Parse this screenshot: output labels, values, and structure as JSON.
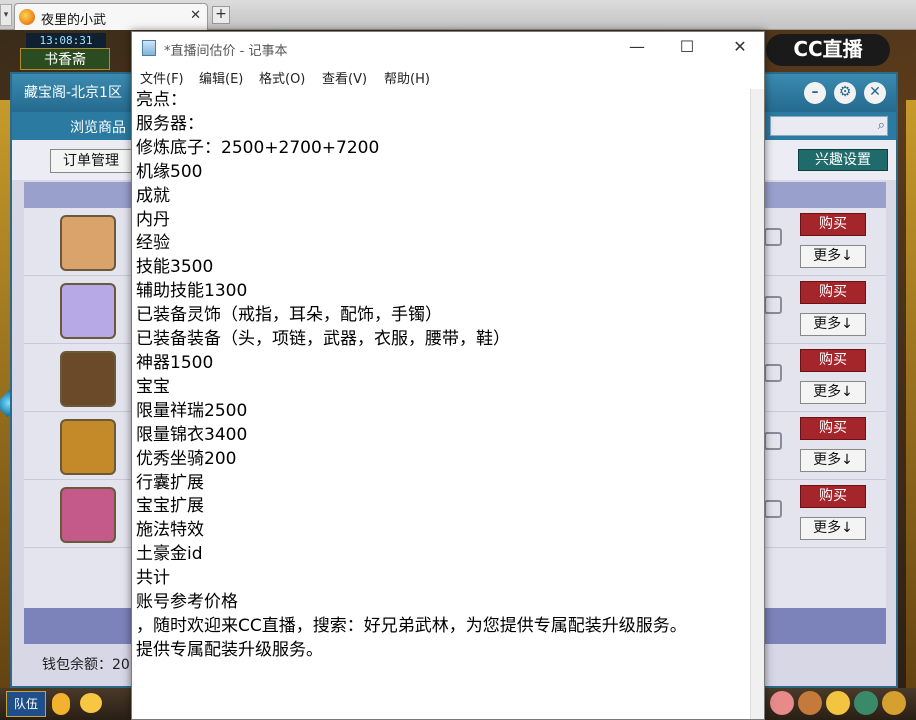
{
  "browser": {
    "tab_title": "夜里的小武",
    "tab_close": "✕",
    "new_tab": "+"
  },
  "game": {
    "clock": "13:08:31",
    "location": "书香斋",
    "team_label": "队伍"
  },
  "cc_logo": "CC直播",
  "treasure": {
    "title": "藏宝阁-北京1区",
    "browse_label": "浏览商品",
    "order_button": "订单管理",
    "interest_button": "兴趣设置",
    "rows": [
      {
        "buy": "购买",
        "more": "更多↓",
        "avatar_color": "#d9a36b"
      },
      {
        "buy": "购买",
        "more": "更多↓",
        "avatar_color": "#b7a8e6"
      },
      {
        "buy": "购买",
        "more": "更多↓",
        "avatar_color": "#6b4a2a"
      },
      {
        "buy": "购买",
        "more": "更多↓",
        "avatar_color": "#c48a2a"
      },
      {
        "buy": "购买",
        "more": "更多↓",
        "avatar_color": "#c45a8a"
      }
    ],
    "wallet_label": "钱包余额：20"
  },
  "notepad": {
    "title": "*直播间估价 - 记事本",
    "menu": [
      "文件(F)",
      "编辑(E)",
      "格式(O)",
      "查看(V)",
      "帮助(H)"
    ],
    "lines": [
      "亮点：",
      "服务器：",
      "修炼底子：2500+2700+7200",
      "机缘500",
      "成就",
      "内丹",
      "经验",
      "技能3500",
      "辅助技能1300",
      "已装备灵饰（戒指，耳朵，配饰，手镯）",
      "已装备装备（头，项链，武器，衣服，腰带，鞋）",
      "神器1500",
      "宝宝",
      "限量祥瑞2500",
      "限量锦衣3400",
      "优秀坐骑200",
      "行囊扩展",
      "宝宝扩展",
      "施法特效",
      "土豪金id",
      "共计",
      "账号参考价格",
      "，随时欢迎来CC直播，搜索：好兄弟武林，为您提供专属配装升级服务。",
      "提供专属配装升级服务。"
    ]
  }
}
